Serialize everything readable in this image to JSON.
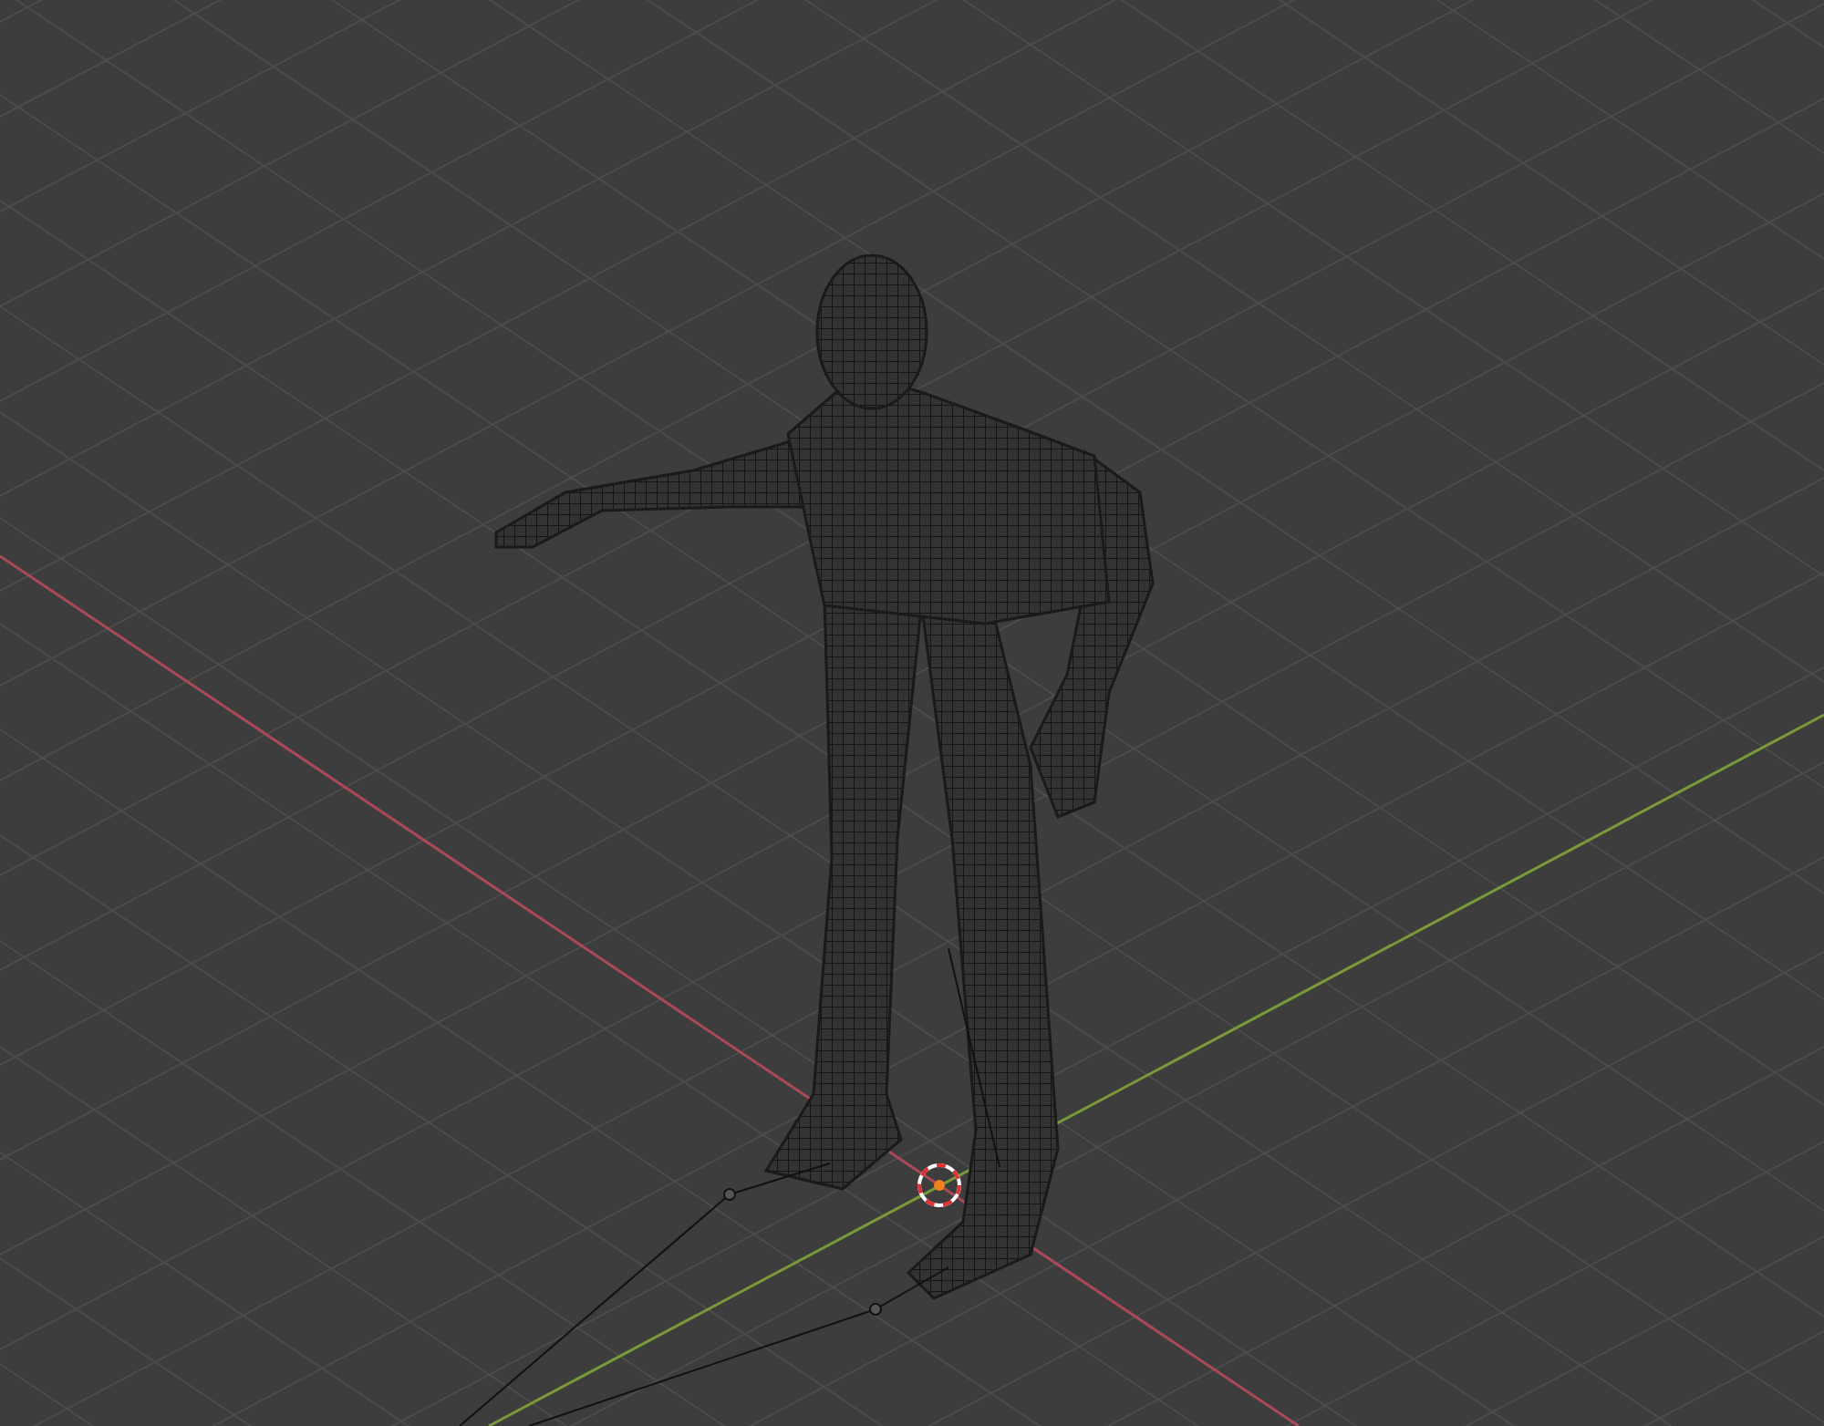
{
  "viewport": {
    "grid": true,
    "x_axis": true,
    "y_axis": true
  }
}
